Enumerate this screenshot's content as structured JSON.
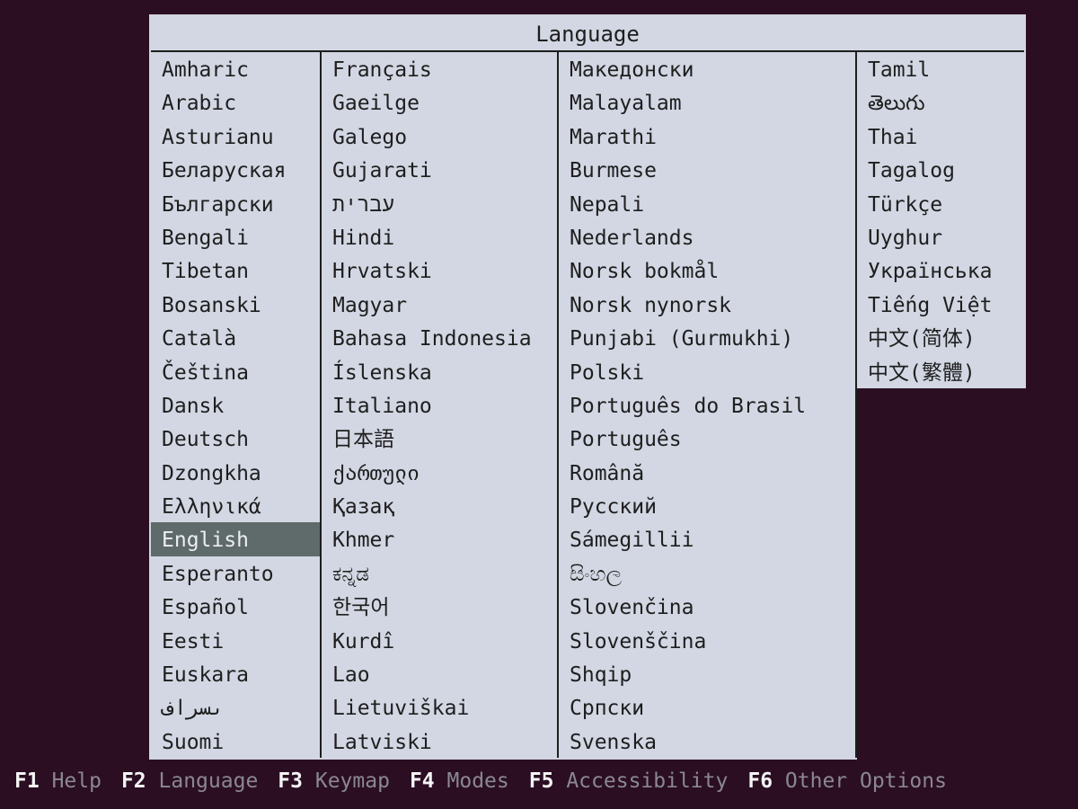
{
  "dialog": {
    "title": "Language",
    "selected": "English",
    "columns": [
      [
        "Amharic",
        "Arabic",
        "Asturianu",
        "Беларуская",
        "Български",
        "Bengali",
        "Tibetan",
        "Bosanski",
        "Català",
        "Čeština",
        "Dansk",
        "Deutsch",
        "Dzongkha",
        "Ελληνικά",
        "English",
        "Esperanto",
        "Español",
        "Eesti",
        "Euskara",
        "ىسراف",
        "Suomi"
      ],
      [
        "Français",
        "Gaeilge",
        "Galego",
        "Gujarati",
        "עברית",
        "Hindi",
        "Hrvatski",
        "Magyar",
        "Bahasa Indonesia",
        "Íslenska",
        "Italiano",
        "日本語",
        "ქართული",
        "Қазақ",
        "Khmer",
        "ಕನ್ನಡ",
        "한국어",
        "Kurdî",
        "Lao",
        "Lietuviškai",
        "Latviski"
      ],
      [
        "Македонски",
        "Malayalam",
        "Marathi",
        "Burmese",
        "Nepali",
        "Nederlands",
        "Norsk bokmål",
        "Norsk nynorsk",
        "Punjabi (Gurmukhi)",
        "Polski",
        "Português do Brasil",
        "Português",
        "Română",
        "Русский",
        "Sámegillii",
        "සිංහල",
        "Slovenčina",
        "Slovenščina",
        "Shqip",
        "Српски",
        "Svenska"
      ],
      [
        "Tamil",
        "తెలుగు",
        "Thai",
        "Tagalog",
        "Türkçe",
        "Uyghur",
        "Українська",
        "Tiếng Việt",
        "中文(简体)",
        "中文(繁體)"
      ]
    ]
  },
  "footer": [
    {
      "key": "F1",
      "label": "Help"
    },
    {
      "key": "F2",
      "label": "Language"
    },
    {
      "key": "F3",
      "label": "Keymap"
    },
    {
      "key": "F4",
      "label": "Modes"
    },
    {
      "key": "F5",
      "label": "Accessibility"
    },
    {
      "key": "F6",
      "label": "Other Options"
    }
  ]
}
